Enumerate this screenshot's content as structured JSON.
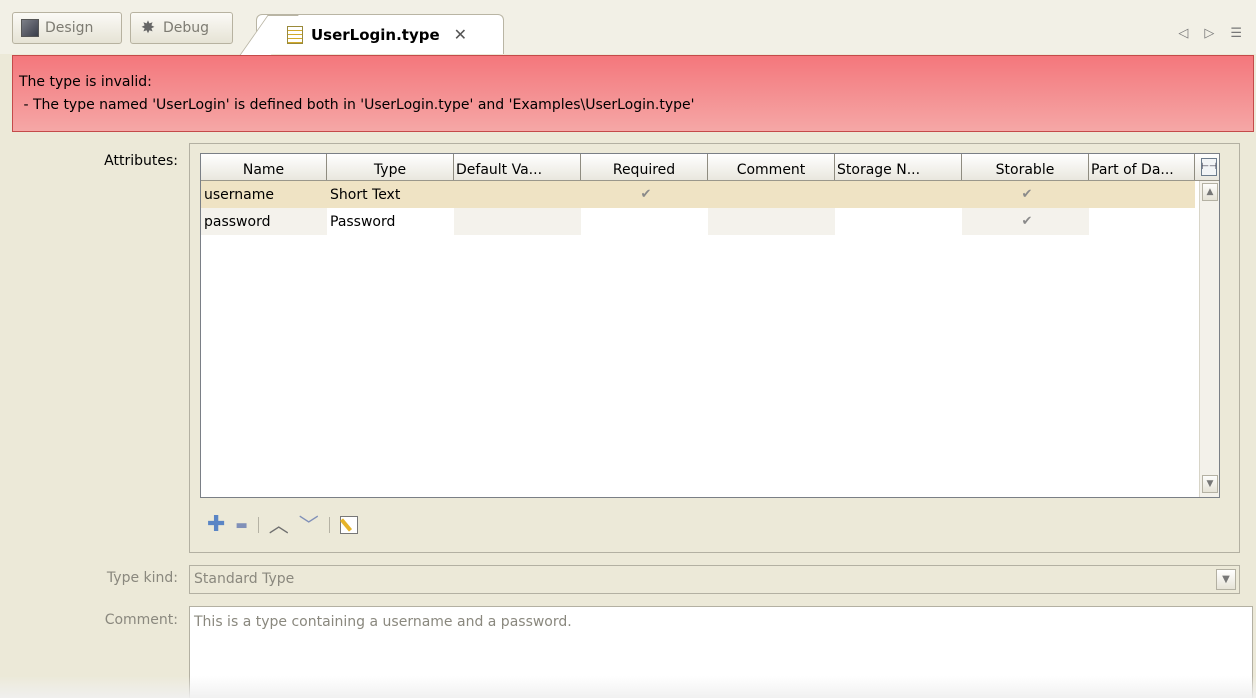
{
  "modes": {
    "design": {
      "label": "Design",
      "icon": "design-icon"
    },
    "debug": {
      "label": "Debug",
      "icon": "debug-bug-icon"
    }
  },
  "editor_tab": {
    "title": "UserLogin.type",
    "close": "✕",
    "icon": "type-file-icon"
  },
  "tab_nav": {
    "prev": "◁",
    "next": "▷",
    "menu": "☰"
  },
  "error": {
    "line1": "The type is invalid:",
    "line2": " - The type named 'UserLogin' is defined both in 'UserLogin.type' and 'Examples\\UserLogin.type'",
    "color": "#f4777c"
  },
  "labels": {
    "attributes": "Attributes:",
    "type_kind": "Type kind:",
    "comment": "Comment:"
  },
  "table": {
    "columns": [
      "Name",
      "Type",
      "Default Va...",
      "Required",
      "Comment",
      "Storage N...",
      "Storable",
      "Part of Da..."
    ],
    "rows": [
      {
        "name": "username",
        "type": "Short Text",
        "default": "",
        "required": "✔",
        "comment": "",
        "storage": "",
        "storable": "✔",
        "part": ""
      },
      {
        "name": "password",
        "type": "Password",
        "default": "",
        "required": "",
        "comment": "",
        "storage": "",
        "storable": "✔",
        "part": ""
      }
    ],
    "selected_row_color": "#efe3c4"
  },
  "toolbar": {
    "add": "✚",
    "remove": "▬",
    "up": "︿",
    "down": "﹀"
  },
  "type_kind": {
    "value": "Standard Type"
  },
  "comment": {
    "value": "This is a type containing a username and a password."
  }
}
